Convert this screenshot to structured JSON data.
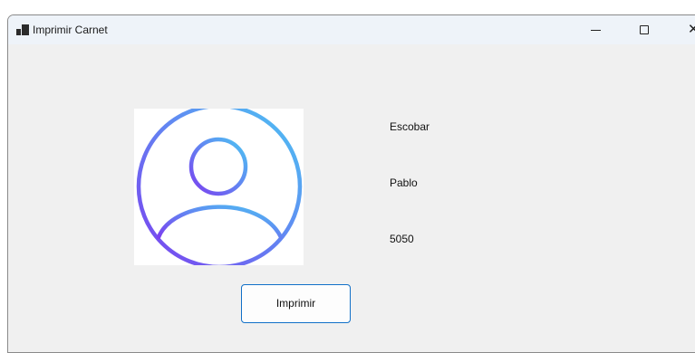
{
  "window": {
    "title": "Imprimir Carnet",
    "close_glyph": "✕",
    "controls": [
      "minimize-icon",
      "maximize-icon",
      "close-icon"
    ]
  },
  "card": {
    "photo_icon": "user-avatar-icon",
    "last_name": "Escobar",
    "first_name": "Pablo",
    "id_number": "5050"
  },
  "actions": {
    "print_label": "Imprimir"
  },
  "colors": {
    "window_bg": "#f0f0f0",
    "titlebar_bg": "#eef3f9",
    "button_border": "#1170c8",
    "avatar_gradient_start": "#4cc5f3",
    "avatar_gradient_end": "#7b3ff0"
  }
}
